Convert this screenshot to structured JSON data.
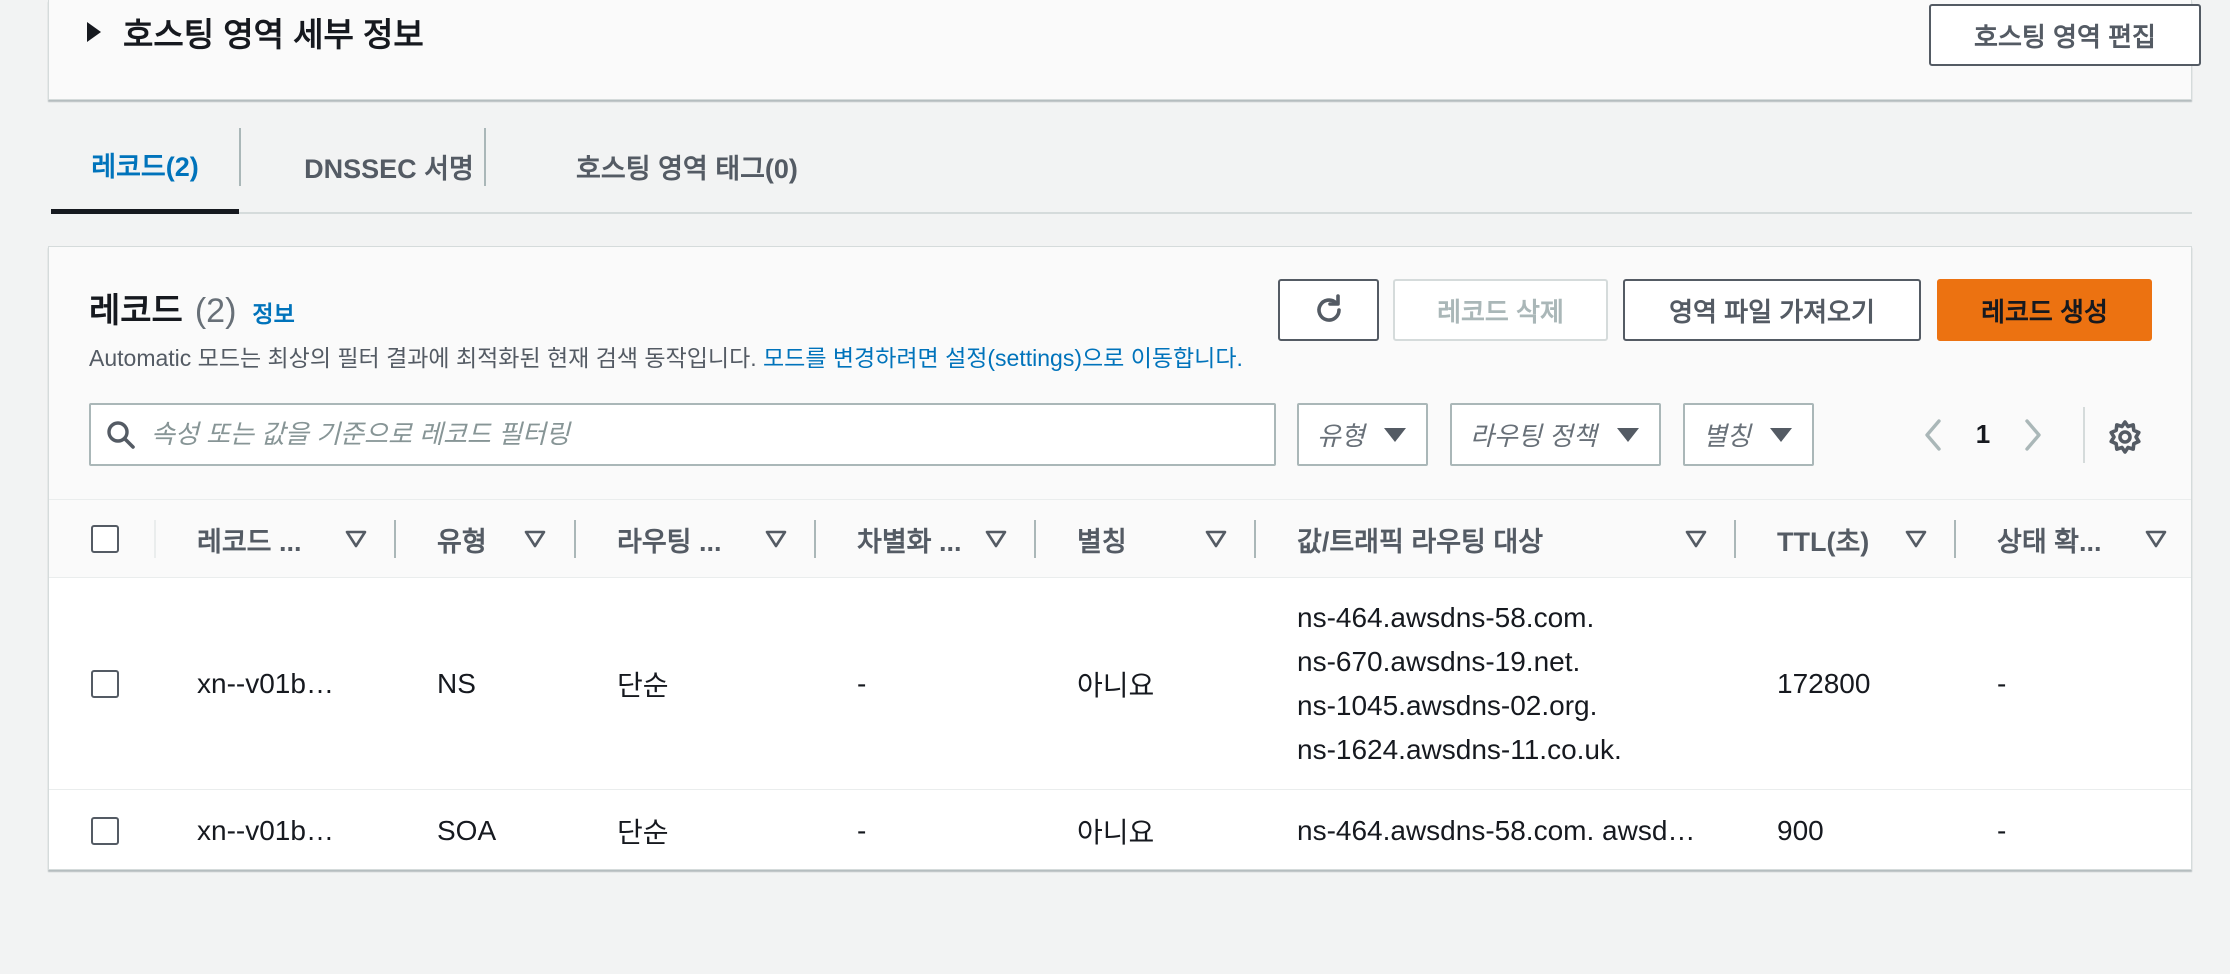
{
  "details": {
    "title": "호스팅 영역 세부 정보",
    "edit_button": "호스팅 영역 편집"
  },
  "tabs": [
    {
      "label": "레코드(2)",
      "active": true
    },
    {
      "label": "DNSSEC 서명",
      "active": false
    },
    {
      "label": "호스팅 영역 태그(0)",
      "active": false
    }
  ],
  "records": {
    "title": "레코드",
    "count": "(2)",
    "info_link": "정보",
    "description": "Automatic 모드는 최상의 필터 결과에 최적화된 현재 검색 동작입니다.",
    "description_link": "모드를 변경하려면 설정(settings)으로 이동합니다.",
    "buttons": {
      "refresh_icon": "refresh-icon",
      "delete": "레코드 삭제",
      "import": "영역 파일 가져오기",
      "create": "레코드 생성"
    },
    "search_placeholder": "속성 또는 값을 기준으로 레코드 필터링",
    "filters": {
      "type": "유형",
      "routing": "라우팅 정책",
      "alias": "별칭"
    },
    "pagination": {
      "current_page": "1"
    },
    "columns": [
      "레코드 ...",
      "유형",
      "라우팅 ...",
      "차별화 ...",
      "별칭",
      "값/트래픽 라우팅 대상",
      "TTL(초)",
      "상태 확..."
    ],
    "rows": [
      {
        "name": "xn--v01b…",
        "type": "NS",
        "routing": "단순",
        "differentiator": "-",
        "alias": "아니요",
        "values": [
          "ns-464.awsdns-58.com.",
          "ns-670.awsdns-19.net.",
          "ns-1045.awsdns-02.org.",
          "ns-1624.awsdns-11.co.uk."
        ],
        "ttl": "172800",
        "health": "-"
      },
      {
        "name": "xn--v01b…",
        "type": "SOA",
        "routing": "단순",
        "differentiator": "-",
        "alias": "아니요",
        "values": [
          "ns-464.awsdns-58.com. awsd…"
        ],
        "ttl": "900",
        "health": "-"
      }
    ]
  },
  "colors": {
    "primary_button": "#ec7211",
    "link": "#0073bb",
    "background": "#f2f3f3"
  }
}
